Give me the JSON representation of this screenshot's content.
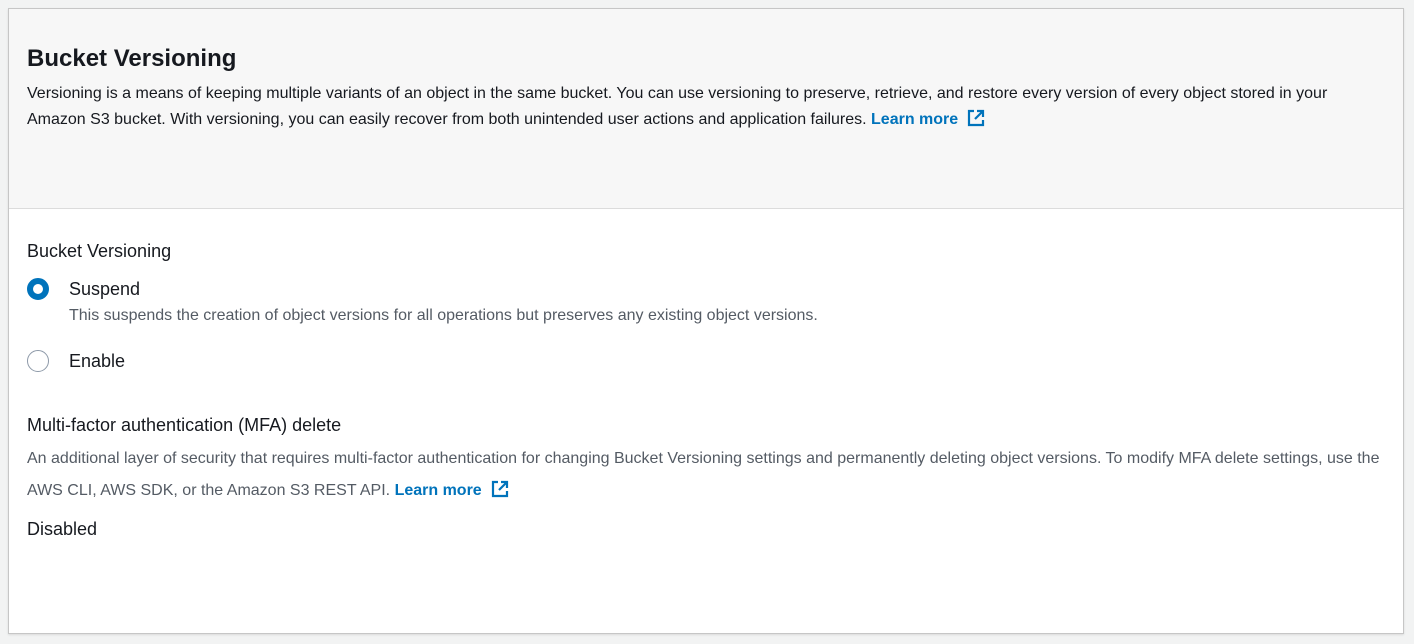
{
  "header": {
    "title": "Bucket Versioning",
    "description": "Versioning is a means of keeping multiple variants of an object in the same bucket. You can use versioning to preserve, retrieve, and restore every version of every object stored in your Amazon S3 bucket. With versioning, you can easily recover from both unintended user actions and application failures.",
    "learn_more": "Learn more"
  },
  "versioning": {
    "label": "Bucket Versioning",
    "options": [
      {
        "label": "Suspend",
        "description": "This suspends the creation of object versions for all operations but preserves any existing object versions.",
        "selected": true
      },
      {
        "label": "Enable",
        "selected": false
      }
    ]
  },
  "mfa": {
    "title": "Multi-factor authentication (MFA) delete",
    "description": "An additional layer of security that requires multi-factor authentication for changing Bucket Versioning settings and permanently deleting object versions. To modify MFA delete settings, use the AWS CLI, AWS SDK, or the Amazon S3 REST API.",
    "learn_more": "Learn more",
    "value": "Disabled"
  },
  "colors": {
    "link": "#0073bb",
    "radio_selected": "#0073bb"
  },
  "icons": {
    "external_link": "external-link-icon"
  }
}
